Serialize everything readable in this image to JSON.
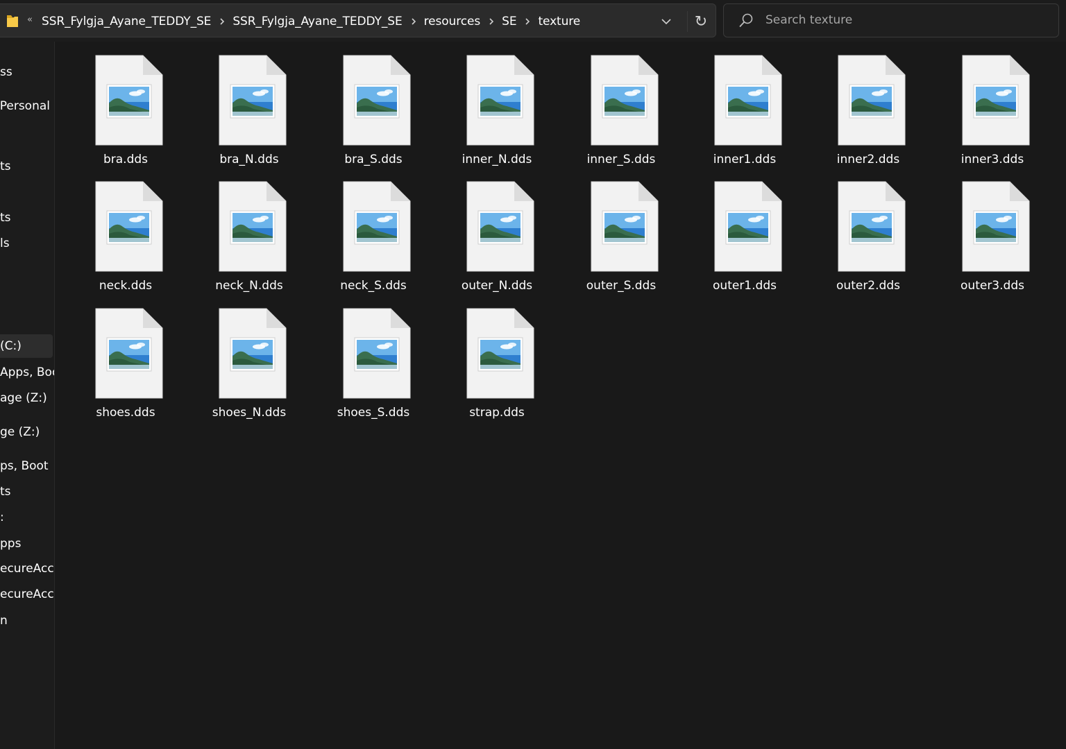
{
  "address_bar": {
    "overflow_glyph": "«",
    "breadcrumbs": [
      "SSR_Fylgja_Ayane_TEDDY_SE",
      "SSR_Fylgja_Ayane_TEDDY_SE",
      "resources",
      "SE",
      "texture"
    ],
    "refresh_glyph": "↻"
  },
  "search": {
    "placeholder": "Search texture"
  },
  "sidebar": {
    "items": [
      "ss",
      "Personal",
      "ts",
      "ts",
      "ls",
      "(C:)",
      "Apps, Boo",
      "age (Z:)",
      "ge (Z:)",
      "ps, Boot",
      "ts",
      ":",
      "pps",
      "ecureAcce",
      "ecureAcce",
      "n"
    ]
  },
  "files": [
    "bra.dds",
    "bra_N.dds",
    "bra_S.dds",
    "inner_N.dds",
    "inner_S.dds",
    "inner1.dds",
    "inner2.dds",
    "inner3.dds",
    "neck.dds",
    "neck_N.dds",
    "neck_S.dds",
    "outer_N.dds",
    "outer_S.dds",
    "outer1.dds",
    "outer2.dds",
    "outer3.dds",
    "shoes.dds",
    "shoes_N.dds",
    "shoes_S.dds",
    "strap.dds"
  ],
  "icons": {
    "folder": "folder-icon",
    "file": "image-file-icon",
    "search": "search-icon",
    "refresh": "refresh-icon",
    "dropdown": "chevron-down-icon"
  },
  "colors": {
    "background": "#191919",
    "panel": "#1c1c1c",
    "address_bg": "#2b2b2b",
    "text": "#ffffff",
    "placeholder": "#a6a6a6",
    "folder_yellow": "#f7c948"
  }
}
